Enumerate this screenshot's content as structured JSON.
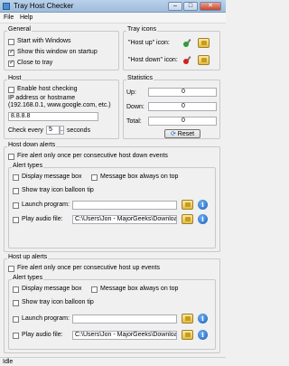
{
  "window": {
    "title": "Tray Host Checker"
  },
  "menu": {
    "file": "File",
    "help": "Help"
  },
  "general": {
    "label": "General",
    "start_with_windows": {
      "label": "Start with Windows",
      "checked": false
    },
    "show_on_startup": {
      "label": "Show this window on startup",
      "checked": true
    },
    "close_to_tray": {
      "label": "Close to tray",
      "checked": true
    }
  },
  "tray_icons": {
    "label": "Tray icons",
    "host_up_label": "\"Host up\" icon:",
    "host_down_label": "\"Host down\" icon:",
    "host_up_color": "#2e9e2e",
    "host_down_color": "#d62020"
  },
  "host": {
    "label": "Host",
    "enable_label": "Enable host checking",
    "enable_checked": false,
    "ip_hint": "IP address or hostname\n(192.168.0.1, www.google.com, etc.)",
    "ip_value": "8.8.8.8",
    "check_every_label": "Check every",
    "check_every_value": "5",
    "seconds_label": "seconds"
  },
  "statistics": {
    "label": "Statistics",
    "up_label": "Up:",
    "up_value": "0",
    "down_label": "Down:",
    "down_value": "0",
    "total_label": "Total:",
    "total_value": "0",
    "reset_label": "Reset"
  },
  "host_down_alerts": {
    "label": "Host down alerts",
    "fire_once": "Fire alert only once per consecutive host down events",
    "alert_types": "Alert types",
    "display_message_box": "Display message box",
    "message_box_on_top": "Message box always on top",
    "show_balloon": "Show tray icon balloon tip",
    "launch_program": "Launch program:",
    "launch_value": "",
    "play_audio": "Play audio file:",
    "audio_value": "C:\\Users\\Jon - MajorGeeks\\Download"
  },
  "host_up_alerts": {
    "label": "Host up alerts",
    "fire_once": "Fire alert only once per consecutive host up events",
    "alert_types": "Alert types",
    "display_message_box": "Display message box",
    "message_box_on_top": "Message box always on top",
    "show_balloon": "Show tray icon balloon tip",
    "launch_program": "Launch program:",
    "launch_value": "",
    "play_audio": "Play audio file:",
    "audio_value": "C:\\Users\\Jon - MajorGeeks\\Download"
  },
  "status": {
    "text": "Idle"
  }
}
